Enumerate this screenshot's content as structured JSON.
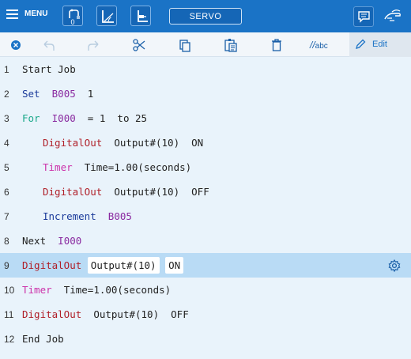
{
  "topbar": {
    "menu_label": "MENU",
    "robot_count": "0",
    "servo_label": "SERVO"
  },
  "edit_toolbar": {
    "abc_prefix": "//",
    "abc_text": "abc",
    "edit_label": "Edit"
  },
  "colors": {
    "topbar": "#1a73c6",
    "background": "#e9f3fb",
    "selected_row": "#b9dbf5",
    "keyword_blue": "#1a3a9a",
    "keyword_teal": "#1aa88a",
    "keyword_red": "#b0202a",
    "keyword_magenta": "#cc33aa",
    "variable_purple": "#8a2aa0"
  },
  "program": {
    "selected_line": 9,
    "lines": [
      {
        "num": "1",
        "parts": [
          {
            "t": "Start Job",
            "c": "kw-job"
          }
        ]
      },
      {
        "num": "2",
        "parts": [
          {
            "t": "Set",
            "c": "kw-set"
          },
          {
            "t": "  ",
            "c": "plain"
          },
          {
            "t": "B005",
            "c": "var"
          },
          {
            "t": "  1",
            "c": "plain"
          }
        ]
      },
      {
        "num": "3",
        "parts": [
          {
            "t": "For",
            "c": "kw-for"
          },
          {
            "t": "  ",
            "c": "plain"
          },
          {
            "t": "I000",
            "c": "var"
          },
          {
            "t": "  = 1  to 25",
            "c": "plain"
          }
        ]
      },
      {
        "num": "4",
        "parts": [
          {
            "t": "DigitalOut",
            "c": "kw-dout"
          },
          {
            "t": "  Output#(10)  ON",
            "c": "plain"
          }
        ]
      },
      {
        "num": "5",
        "parts": [
          {
            "t": "Timer",
            "c": "kw-timer"
          },
          {
            "t": "  Time=1.00(seconds)",
            "c": "plain"
          }
        ]
      },
      {
        "num": "6",
        "parts": [
          {
            "t": "DigitalOut",
            "c": "kw-dout"
          },
          {
            "t": "  Output#(10)  OFF",
            "c": "plain"
          }
        ]
      },
      {
        "num": "7",
        "parts": [
          {
            "t": "Increment",
            "c": "kw-inc"
          },
          {
            "t": "  ",
            "c": "plain"
          },
          {
            "t": "B005",
            "c": "var"
          }
        ]
      },
      {
        "num": "8",
        "parts": [
          {
            "t": "Next",
            "c": "kw-next"
          },
          {
            "t": "  ",
            "c": "plain"
          },
          {
            "t": "I000",
            "c": "var"
          }
        ]
      },
      {
        "num": "9",
        "parts": [
          {
            "t": "DigitalOut",
            "c": "kw-dout"
          },
          {
            "t": " ",
            "c": "plain"
          },
          {
            "t": "Output#(10)",
            "c": "plain chip"
          },
          {
            "t": " ",
            "c": "plain"
          },
          {
            "t": "ON",
            "c": "plain chip"
          }
        ]
      },
      {
        "num": "10",
        "parts": [
          {
            "t": "Timer",
            "c": "kw-timer"
          },
          {
            "t": "  Time=1.00(seconds)",
            "c": "plain"
          }
        ]
      },
      {
        "num": "11",
        "parts": [
          {
            "t": "DigitalOut",
            "c": "kw-dout"
          },
          {
            "t": "  Output#(10)  OFF",
            "c": "plain"
          }
        ]
      },
      {
        "num": "12",
        "parts": [
          {
            "t": "End Job",
            "c": "kw-job"
          }
        ]
      }
    ]
  }
}
